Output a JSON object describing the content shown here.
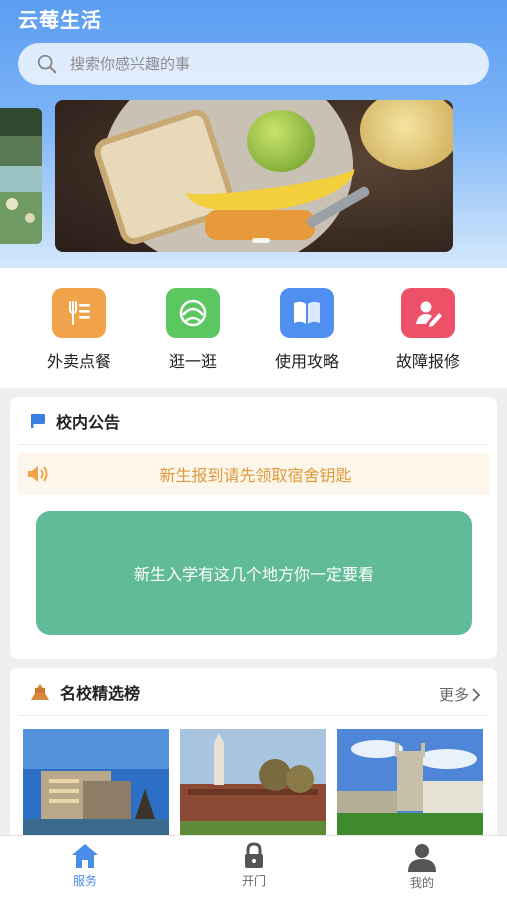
{
  "app": {
    "title": "云莓生活"
  },
  "search": {
    "placeholder": "搜索你感兴趣的事"
  },
  "quick_menu": [
    {
      "label": "外卖点餐",
      "icon": "food-order-icon",
      "color": "#f0a34a"
    },
    {
      "label": "逛一逛",
      "icon": "browse-icon",
      "color": "#5cc760"
    },
    {
      "label": "使用攻略",
      "icon": "guide-book-icon",
      "color": "#4f8ff0"
    },
    {
      "label": "故障报修",
      "icon": "repair-report-icon",
      "color": "#ec5168"
    }
  ],
  "announcement": {
    "title": "校内公告",
    "notice_text": "新生报到请先领取宿舍钥匙",
    "featured_text": "新生入学有这几个地方你一定要看"
  },
  "schools": {
    "title": "名校精选榜",
    "more_label": "更多"
  },
  "tabbar": [
    {
      "label": "服务",
      "icon": "home-icon",
      "active": true
    },
    {
      "label": "开门",
      "icon": "lock-icon",
      "active": false
    },
    {
      "label": "我的",
      "icon": "user-icon",
      "active": false
    }
  ],
  "colors": {
    "accent": "#4a8de8",
    "notice_text": "#e09a3c",
    "featured_bg": "#62bb98"
  }
}
